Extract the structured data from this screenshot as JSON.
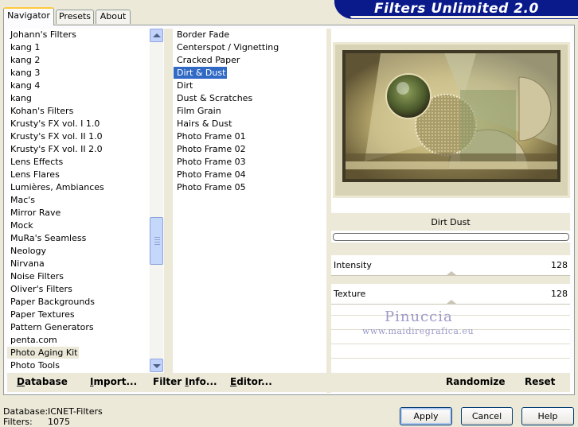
{
  "banner": {
    "title": "Filters Unlimited 2.0"
  },
  "tabs": [
    {
      "label": "Navigator",
      "active": true
    },
    {
      "label": "Presets",
      "active": false
    },
    {
      "label": "About",
      "active": false
    }
  ],
  "categories": [
    "Johann's Filters",
    "kang 1",
    "kang 2",
    "kang 3",
    "kang 4",
    "kang",
    "Kohan's Filters",
    "Krusty's FX vol. I 1.0",
    "Krusty's FX vol. II 1.0",
    "Krusty's FX vol. II 2.0",
    "Lens Effects",
    "Lens Flares",
    "Lumières, Ambiances",
    "Mac's",
    "Mirror Rave",
    "Mock",
    "MuRa's Seamless",
    "Neology",
    "Nirvana",
    "Noise Filters",
    "Oliver's Filters",
    "Paper Backgrounds",
    "Paper Textures",
    "Pattern Generators",
    "penta.com",
    "Photo Aging Kit",
    "Photo Tools"
  ],
  "category_highlighted": 25,
  "filters": [
    "Border Fade",
    "Centerspot / Vignetting",
    "Cracked Paper",
    "Dirt & Dust",
    "Dirt",
    "Dust & Scratches",
    "Film Grain",
    "Hairs & Dust",
    "Photo Frame 01",
    "Photo Frame 02",
    "Photo Frame 03",
    "Photo Frame 04",
    "Photo Frame 05"
  ],
  "filter_selected": 3,
  "left_actions": {
    "database": {
      "pre": "",
      "u": "D",
      "post": "atabase"
    },
    "import": {
      "pre": "",
      "u": "I",
      "post": "mport..."
    },
    "filter_info": {
      "pre": "Filter ",
      "u": "I",
      "post": "nfo..."
    },
    "editor": {
      "pre": "",
      "u": "E",
      "post": "ditor..."
    }
  },
  "preview": {
    "filter_name": "Dirt  Dust"
  },
  "params": [
    {
      "label": "Intensity",
      "value": "128"
    },
    {
      "label": "Texture",
      "value": "128"
    }
  ],
  "watermark": {
    "name": "Pinuccia",
    "url": "www.maidiregrafica.eu"
  },
  "right_actions": {
    "randomize": "Randomize",
    "reset": "Reset"
  },
  "footer": {
    "database_label": "Database:",
    "database_value": "ICNET-Filters",
    "filters_label": "Filters:",
    "filters_value": "1075"
  },
  "buttons": {
    "apply": "Apply",
    "cancel": "Cancel",
    "help": "Help"
  },
  "colors": {
    "banner": "#0a1a8a",
    "selection": "#316ac5",
    "tab_accent": "#ffc83c"
  }
}
